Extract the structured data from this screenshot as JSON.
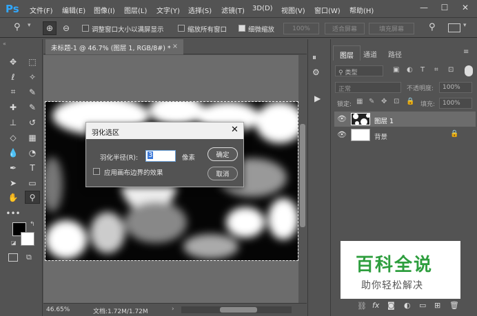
{
  "app": {
    "logo": "Ps"
  },
  "menu": [
    "文件(F)",
    "编辑(E)",
    "图像(I)",
    "图层(L)",
    "文字(Y)",
    "选择(S)",
    "滤镜(T)",
    "3D(D)",
    "视图(V)",
    "窗口(W)",
    "帮助(H)"
  ],
  "options": {
    "resize_windows": "调整窗口大小以满屏显示",
    "zoom_all": "缩放所有窗口",
    "scrubby_zoom": "细微缩放",
    "zoom_pct": "100%",
    "fit_screen": "适合屏幕",
    "fill_screen": "填充屏幕"
  },
  "document": {
    "tab_title": "未标题-1 @ 46.7% (图层 1, RGB/8#) *",
    "zoom": "46.65%",
    "doc_info": "文档:1.72M/1.72M"
  },
  "dialog": {
    "title": "羽化选区",
    "radius_label": "羽化半径(R):",
    "radius_value": "3",
    "unit": "像素",
    "ok": "确定",
    "cancel": "取消",
    "apply_edge": "应用画布边界的效果"
  },
  "layers_panel": {
    "tabs": [
      "图层",
      "通道",
      "路径"
    ],
    "filter_kind": "类型",
    "blend_mode": "正常",
    "opacity_label": "不透明度:",
    "opacity": "100%",
    "lock_label": "锁定:",
    "fill_label": "填充:",
    "fill": "100%",
    "layers": [
      {
        "name": "图层 1"
      },
      {
        "name": "背景"
      }
    ]
  },
  "watermark": {
    "title": "百科全说",
    "subtitle": "助你轻松解决"
  },
  "colors": {
    "accent": "#31a8ff",
    "watermark_green": "#2e9e3e"
  }
}
